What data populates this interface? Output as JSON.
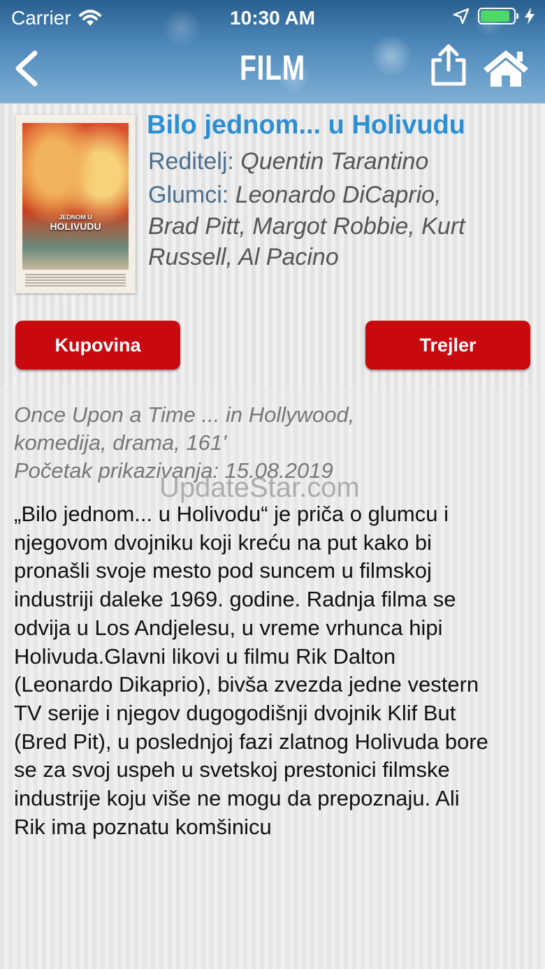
{
  "status_bar": {
    "carrier": "Carrier",
    "time": "10:30 AM",
    "battery_color": "#4cd964",
    "battery_level": 0.9
  },
  "nav": {
    "title": "FILM",
    "back_icon": "chevron-left-icon",
    "share_icon": "share-icon",
    "home_icon": "home-icon"
  },
  "movie": {
    "title": "Bilo jednom... u Holivudu",
    "director_label": "Reditelj:",
    "director": "Quentin Tarantino",
    "cast_label": "Glumci:",
    "cast_line1": "Leonardo DiCaprio,",
    "cast_line2": "Brad Pitt, Margot Robbie, Kurt",
    "cast_line3": "Russell, Al Pacino",
    "poster_title": "HOLIVUDU",
    "poster_subtitle": "JEDNOM U"
  },
  "buttons": {
    "buy": "Kupovina",
    "trailer": "Trejler",
    "color": "#c80a10"
  },
  "details": {
    "original_title": "Once Upon a Time ... in Hollywood,",
    "genre_duration": "komedija, drama, 161'",
    "premiere": "Početak prikazivanja: 15.08.2019",
    "watermark": "UpdateStar.com",
    "description": "„Bilo jednom... u Holivodu“ je priča o glumcu i njegovom dvojniku koji kreću na put kako bi pronašli svoje mesto pod suncem u filmskoj industriji daleke 1969. godine. Radnja filma se odvija u Los Andjelesu, u vreme vrhunca hipi Holivuda.Glavni likovi u filmu Rik Dalton (Leonardo Dikaprio), bivša zvezda jedne vestern TV serije i njegov dugogodišnji dvojnik Klif But (Bred Pit), u poslednjoj fazi zlatnog Holivuda bore se za svoj uspeh u svetskoj prestonici filmske industrije koju više ne mogu da prepoznaju. Ali Rik ima poznatu komšinicu"
  }
}
